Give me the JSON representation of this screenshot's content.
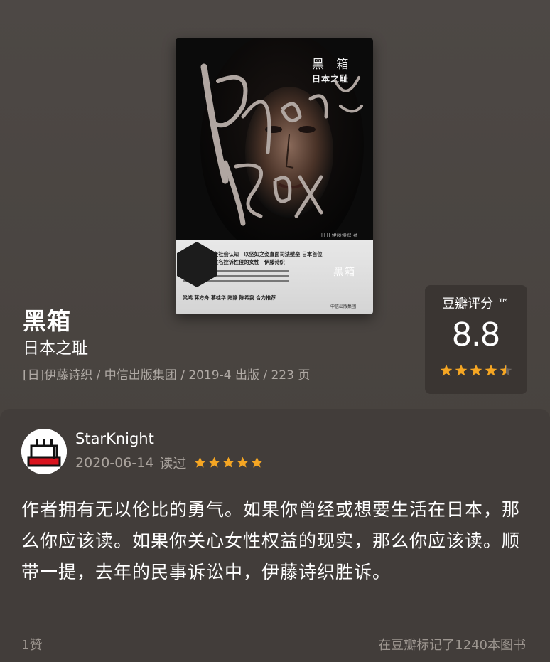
{
  "book": {
    "title": "黑箱",
    "subtitle": "日本之耻",
    "meta": "[日]伊藤诗织 / 中信出版集团 / 2019-4 出版 / 223 页"
  },
  "cover": {
    "title": "黑 箱",
    "subtitle": "日本之耻",
    "author": "[日] 伊藤诗织 著",
    "tagline": "凭一己之力改变社会认知　以坚如之姿直面司法壁垒 日本首位以公开长相和姓名控诉性侵的女性　伊藤诗织",
    "blurb": "梁鸿 蒋方舟 慕桂华 陆静 陈希我 合力推荐",
    "hex_label": "黑箱",
    "publisher": "中信出版集团"
  },
  "rating": {
    "label": "豆瓣评分 ™",
    "score": "8.8",
    "stars": 4.5,
    "star_color": "#f5a623"
  },
  "review": {
    "username": "StarKnight",
    "date": "2020-06-14",
    "status": "读过",
    "stars": 5,
    "text": "作者拥有无以伦比的勇气。如果你曾经或想要生活在日本，那么你应该读。如果你关心女性权益的现实，那么你应该读。顺带一提，去年的民事诉讼中，伊藤诗织胜诉。",
    "likes": "1赞",
    "marked": "在豆瓣标记了1240本图书"
  },
  "colors": {
    "background": "#4a4542",
    "card": "#423d3a",
    "rating_card": "#3a3532",
    "star": "#f5a623"
  }
}
